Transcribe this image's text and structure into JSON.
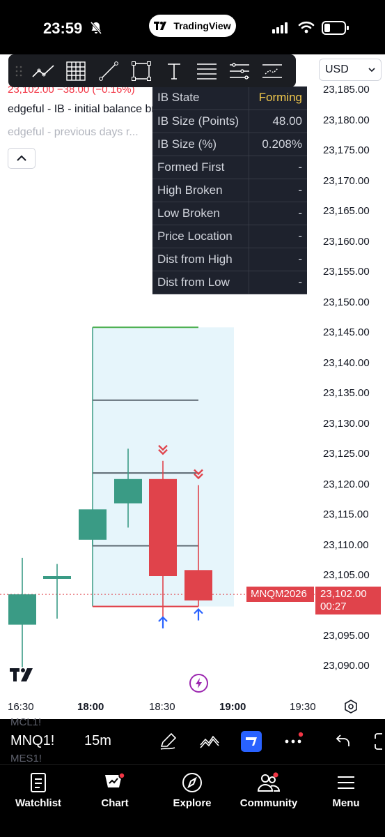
{
  "status_bar": {
    "time": "23:59"
  },
  "tv_pill": {
    "label": "TradingView"
  },
  "toolbar": {
    "currency": "USD",
    "tools": [
      "trend-line-icon",
      "grid-icon",
      "line-icon",
      "rectangle-icon",
      "text-icon",
      "long-position-icon",
      "fib-icon",
      "pattern-icon"
    ]
  },
  "legend": {
    "price_line": "23,102.00 −38.00 (−0.16%)",
    "indicator_1": "edgeful - IB - initial balance breakout",
    "indicator_2": "edgeful - previous days r..."
  },
  "ib_table": {
    "rows": [
      {
        "label": "IB State",
        "value": "Forming"
      },
      {
        "label": "IB Size (Points)",
        "value": "48.00"
      },
      {
        "label": "IB Size (%)",
        "value": "0.208%"
      },
      {
        "label": "Formed First",
        "value": "-"
      },
      {
        "label": "High Broken",
        "value": "-"
      },
      {
        "label": "Low Broken",
        "value": "-"
      },
      {
        "label": "Price Location",
        "value": "-"
      },
      {
        "label": "Dist from High",
        "value": "-"
      },
      {
        "label": "Dist from Low",
        "value": "-"
      }
    ]
  },
  "price_axis": {
    "labels": [
      "23,185.00",
      "23,180.00",
      "23,175.00",
      "23,170.00",
      "23,165.00",
      "23,160.00",
      "23,155.00",
      "23,150.00",
      "23,145.00",
      "23,140.00",
      "23,135.00",
      "23,130.00",
      "23,125.00",
      "23,120.00",
      "23,115.00",
      "23,110.00",
      "23,105.00",
      "23,095.00",
      "23,090.00"
    ],
    "last_price": "23,102.00",
    "countdown": "00:27",
    "symbol_tag": "MNQM2026"
  },
  "time_axis": {
    "labels": [
      "16:30",
      "18:00",
      "18:30",
      "19:00",
      "19:30"
    ]
  },
  "chart_data": {
    "type": "candlestick",
    "interval": "15m",
    "candles": [
      {
        "time": "16:30",
        "open": 23097,
        "high": 23108,
        "low": 23090,
        "close": 23102
      },
      {
        "time": "16:45",
        "open": 23105,
        "high": 23107,
        "low": 23098,
        "close": 23105
      },
      {
        "time": "18:00",
        "open": 23111,
        "high": 23116,
        "low": 23110,
        "close": 23116
      },
      {
        "time": "18:15",
        "open": 23117,
        "high": 23126,
        "low": 23113,
        "close": 23121
      },
      {
        "time": "18:30",
        "open": 23121,
        "high": 23124,
        "low": 23098,
        "close": 23105
      },
      {
        "time": "18:45",
        "open": 23106,
        "high": 23120,
        "low": 23100,
        "close": 23101
      }
    ],
    "ib_box": {
      "high": 23146,
      "low": 23100,
      "levels": [
        23134,
        23122,
        23110
      ]
    },
    "last_price": 23102,
    "ylim": [
      23087,
      23188
    ],
    "colors": {
      "up": "#3a9b85",
      "down": "#e0434b",
      "ib_fill": "#e6f5fb",
      "ib_high": "#4caf50",
      "ib_low": "#e0434b",
      "level": "#5b6770",
      "arrow_up": "#2962ff"
    }
  },
  "symbol_bar": {
    "ghost_top": "MCL1!",
    "symbol": "MNQ1!",
    "ghost_bottom": "MES1!",
    "interval": "15m"
  },
  "bottom_nav": {
    "items": [
      {
        "label": "Watchlist",
        "icon": "watchlist-icon"
      },
      {
        "label": "Chart",
        "icon": "chart-icon"
      },
      {
        "label": "Explore",
        "icon": "compass-icon"
      },
      {
        "label": "Community",
        "icon": "community-icon"
      },
      {
        "label": "Menu",
        "icon": "menu-icon"
      }
    ]
  }
}
